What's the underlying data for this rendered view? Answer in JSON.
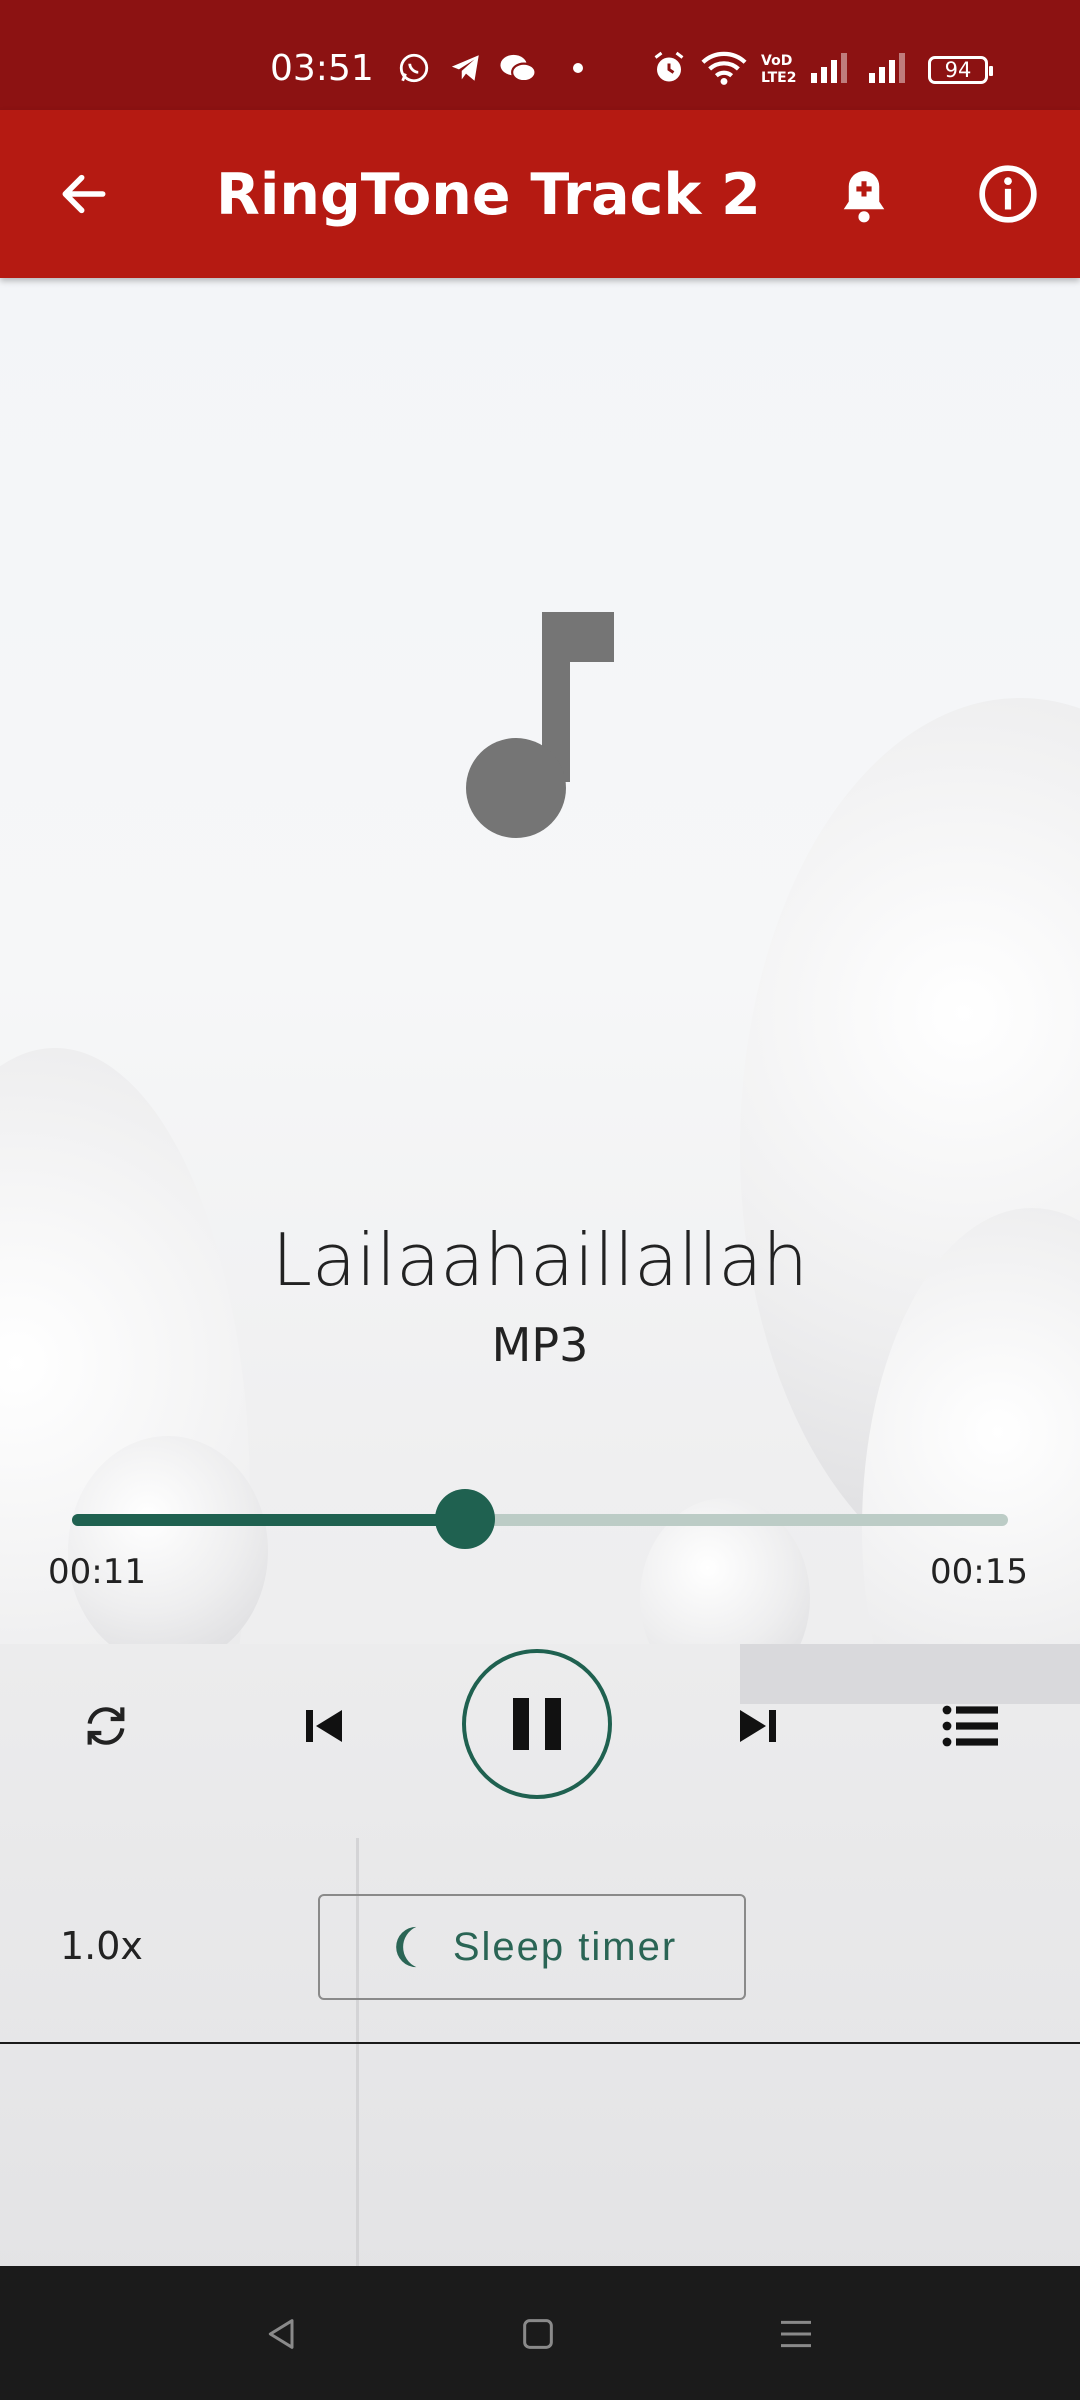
{
  "status_bar": {
    "time": "03:51",
    "battery": "94",
    "icons": [
      "whatsapp-icon",
      "telegram-icon",
      "wechat-icon",
      "dot-icon",
      "alarm-icon",
      "wifi-icon",
      "volte-icon",
      "signal-icon",
      "signal-icon",
      "battery-icon"
    ]
  },
  "app_bar": {
    "title": "RingTone Track 2",
    "icons": [
      "back-arrow-icon",
      "bell-plus-icon",
      "info-icon"
    ]
  },
  "track": {
    "title": "Lailaahaillallah",
    "format": "MP3",
    "icon": "music-note-icon"
  },
  "player": {
    "elapsed": "00:11",
    "duration": "00:15",
    "progress": 0.42,
    "speed": "1.0x",
    "sleep_timer_label": "Sleep timer",
    "controls": [
      "repeat-icon",
      "previous-icon",
      "pause-icon",
      "next-icon",
      "playlist-icon"
    ]
  },
  "colors": {
    "status_bar": "#8c1212",
    "app_bar": "#b51a12",
    "accent": "#1f6150",
    "nav_bar": "#1b1b1b"
  },
  "nav_bar": {
    "icons": [
      "nav-back-icon",
      "nav-home-icon",
      "nav-menu-icon"
    ]
  }
}
